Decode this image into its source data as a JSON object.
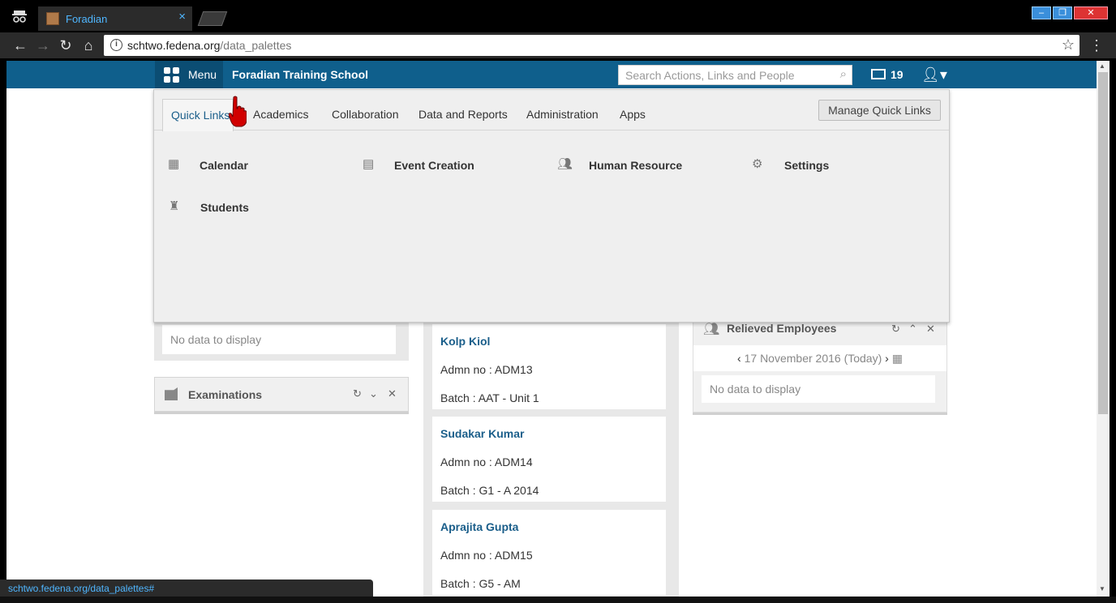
{
  "browser": {
    "tab_title": "Foradian",
    "tab_close": "×",
    "url_host": "schtwo.fedena.org",
    "url_path": "/data_palettes",
    "status_url": "schtwo.fedena.org/data_palettes#"
  },
  "appbar": {
    "menu_label": "Menu",
    "school_name": "Foradian Training School",
    "search_placeholder": "Search Actions, Links and People",
    "mail_count": "19"
  },
  "menu": {
    "tabs": [
      "Quick Links",
      "Academics",
      "Collaboration",
      "Data and Reports",
      "Administration",
      "Apps"
    ],
    "manage_label": "Manage Quick Links",
    "quick_links": [
      {
        "label": "Calendar",
        "icon": "calendar-icon"
      },
      {
        "label": "Event Creation",
        "icon": "event-creation-icon"
      },
      {
        "label": "Human Resource",
        "icon": "human-resource-icon"
      },
      {
        "label": "Settings",
        "icon": "settings-icon"
      },
      {
        "label": "Students",
        "icon": "students-icon"
      }
    ]
  },
  "widgets": {
    "left_nodata": "No data to display",
    "examinations_title": "Examinations",
    "students": [
      {
        "name": "Kolp Kiol",
        "adm": "Admn no : ADM13",
        "batch": "Batch : AAT - Unit 1"
      },
      {
        "name": "Sudakar Kumar",
        "adm": "Admn no : ADM14",
        "batch": "Batch : G1 - A 2014"
      },
      {
        "name": "Aprajita Gupta",
        "adm": "Admn no : ADM15",
        "batch": "Batch : G5 - AM"
      }
    ],
    "relieved": {
      "title": "Relieved Employees",
      "date": "17 November 2016 (Today)",
      "nodata": "No data to display"
    }
  },
  "colors": {
    "appbar": "#0f5f8c",
    "menu_button": "#0b4d73",
    "link_blue": "#1a5e8a"
  }
}
